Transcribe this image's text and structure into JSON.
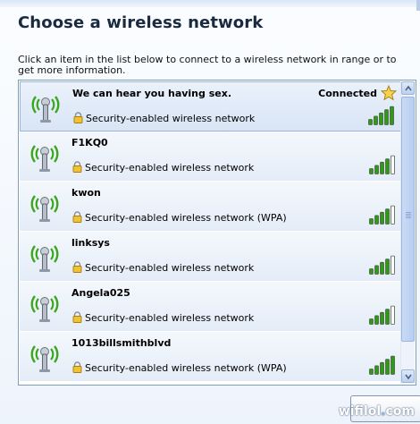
{
  "panel": {
    "heading": "Choose a wireless network",
    "description": "Click an item in the list below to connect to a wireless network in range or to get more information."
  },
  "networks": [
    {
      "name": "We can hear you having sex.",
      "security": "Security-enabled wireless network",
      "status": "Connected",
      "signal_bars": 5,
      "selected": true
    },
    {
      "name": "F1KQ0",
      "security": "Security-enabled wireless network",
      "status": "",
      "signal_bars": 4,
      "selected": false
    },
    {
      "name": "kwon",
      "security": "Security-enabled wireless network (WPA)",
      "status": "",
      "signal_bars": 4,
      "selected": false
    },
    {
      "name": "linksys",
      "security": "Security-enabled wireless network",
      "status": "",
      "signal_bars": 4,
      "selected": false
    },
    {
      "name": "Angela025",
      "security": "Security-enabled wireless network",
      "status": "",
      "signal_bars": 4,
      "selected": false
    },
    {
      "name": "1013billsmithblvd",
      "security": "Security-enabled wireless network (WPA)",
      "status": "",
      "signal_bars": 5,
      "selected": false
    }
  ],
  "watermark": {
    "brand": "wifilol",
    "dot": ".",
    "tld": "com"
  },
  "colors": {
    "signal_on": "#2f9a16",
    "signal_off": "#ffffff",
    "antenna_waves": "#3aa61c"
  },
  "icons": {
    "network": "wireless-antenna-icon",
    "lock": "padlock-icon",
    "signal": "signal-strength-icon",
    "star": "star-icon"
  }
}
